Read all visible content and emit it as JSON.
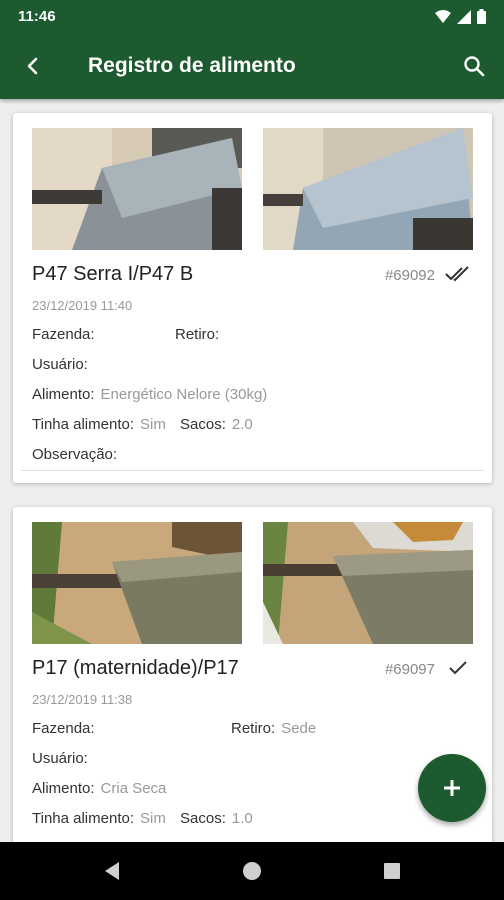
{
  "status_bar": {
    "time": "11:46",
    "icons": [
      "wifi-icon",
      "signal-icon",
      "battery-icon"
    ]
  },
  "app_bar": {
    "title": "Registro de alimento",
    "back_icon": "arrow-left-icon",
    "search_icon": "search-icon"
  },
  "colors": {
    "primary": "#1e5a2f",
    "muted_text": "#999999",
    "background": "#eeeeee"
  },
  "records": [
    {
      "title": "P47 Serra I/P47 B",
      "id": "#69092",
      "sync_icon": "double-check-icon",
      "date": "23/12/2019 11:40",
      "fields": {
        "fazenda_label": "Fazenda:",
        "fazenda_value": "",
        "retiro_label": "Retiro:",
        "retiro_value": "",
        "usuario_label": "Usuário:",
        "usuario_value": "",
        "alimento_label": "Alimento:",
        "alimento_value": "Energético Nelore (30kg)",
        "tinha_label": "Tinha alimento:",
        "tinha_value": "Sim",
        "sacos_label": "Sacos:",
        "sacos_value": "2.0",
        "observacao_label": "Observação:",
        "observacao_value": ""
      }
    },
    {
      "title": "P17 (maternidade)/P17",
      "id": "#69097",
      "sync_icon": "check-icon",
      "date": "23/12/2019 11:38",
      "fields": {
        "fazenda_label": "Fazenda:",
        "fazenda_value": "",
        "retiro_label": "Retiro:",
        "retiro_value": "Sede",
        "usuario_label": "Usuário:",
        "usuario_value": "",
        "alimento_label": "Alimento:",
        "alimento_value": "Cria Seca",
        "tinha_label": "Tinha alimento:",
        "tinha_value": "Sim",
        "sacos_label": "Sacos:",
        "sacos_value": "1.0"
      }
    }
  ],
  "fab": {
    "icon": "plus-icon"
  },
  "nav_bar": {
    "icons": [
      "back-triangle-icon",
      "home-circle-icon",
      "recents-square-icon"
    ]
  }
}
